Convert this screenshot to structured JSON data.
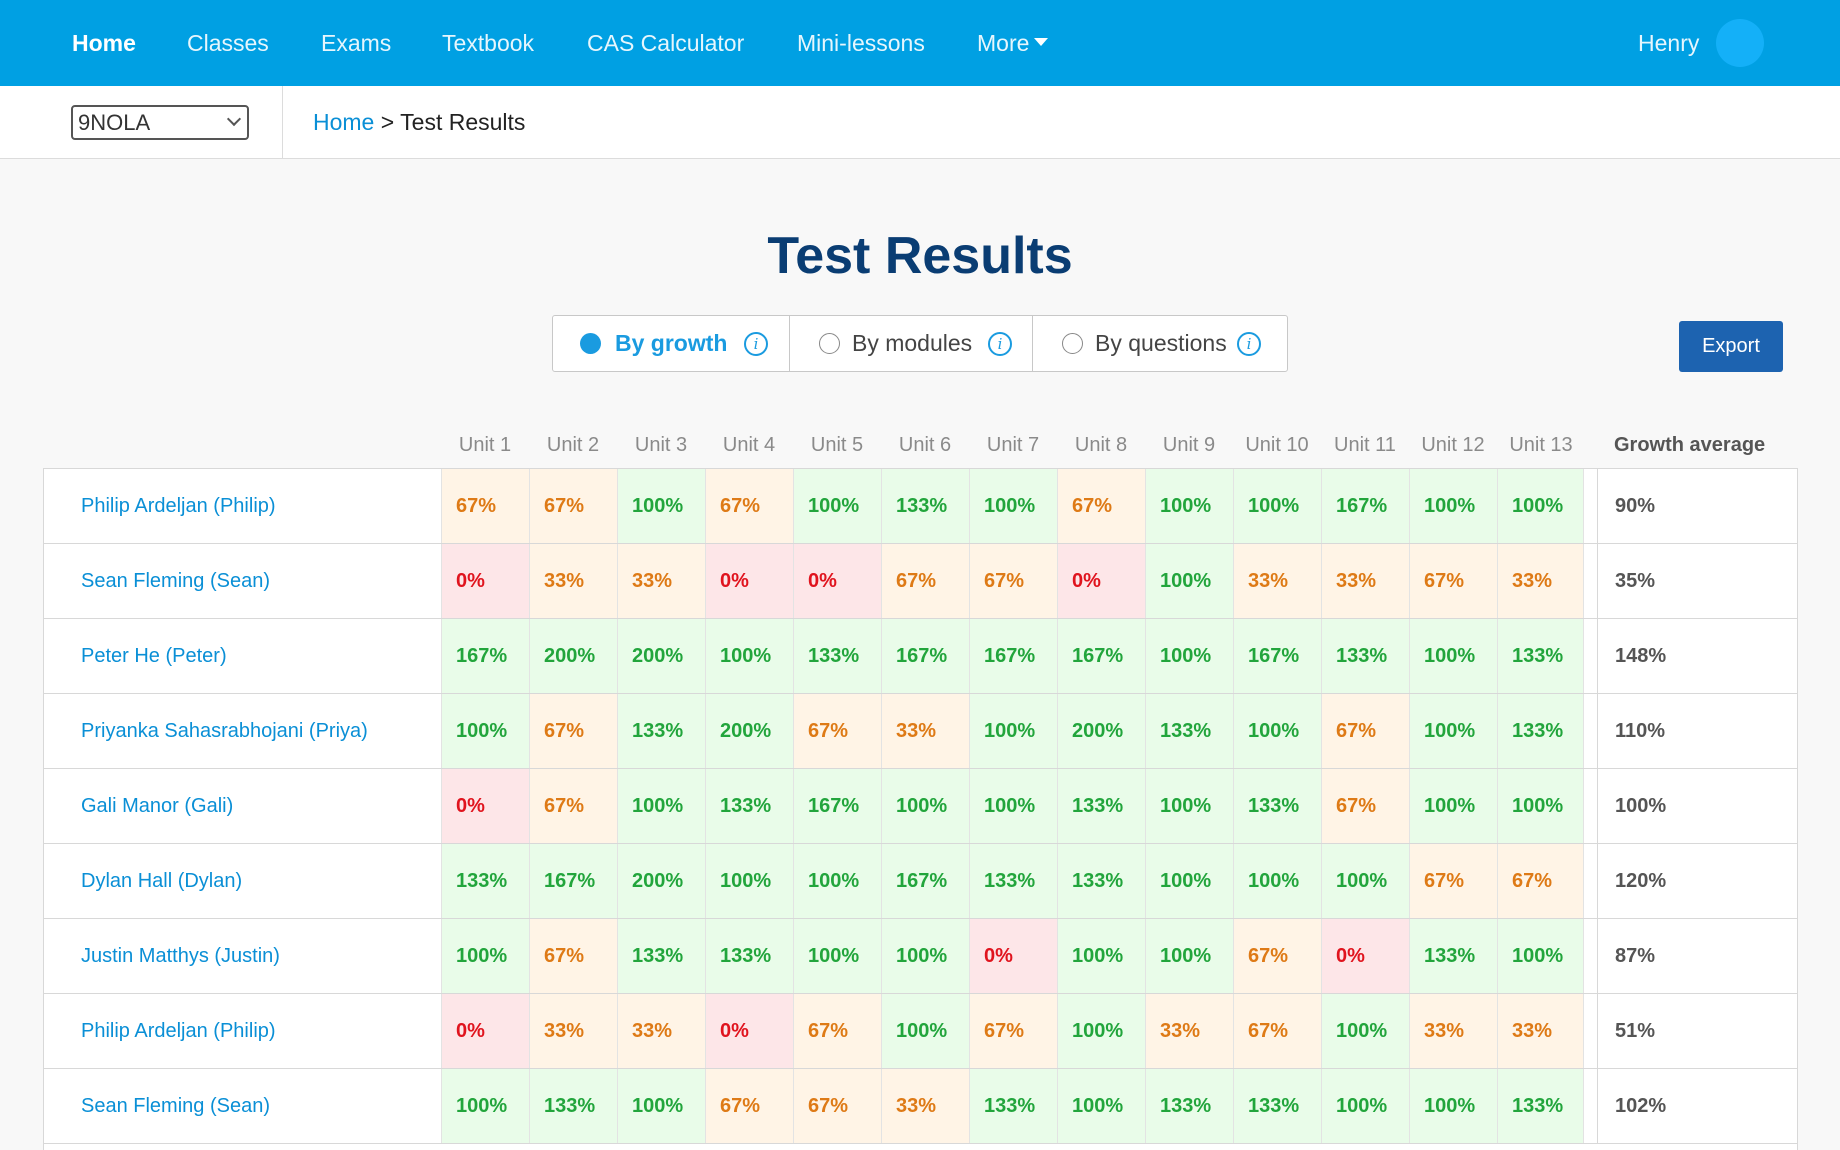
{
  "nav": {
    "items": [
      {
        "label": "Home",
        "active": true
      },
      {
        "label": "Classes"
      },
      {
        "label": "Exams"
      },
      {
        "label": "Textbook"
      },
      {
        "label": "CAS Calculator"
      },
      {
        "label": "Mini-lessons"
      },
      {
        "label": "More"
      }
    ],
    "user_name": "Henry",
    "colors": {
      "bar": "#00a0e3"
    }
  },
  "class_select": {
    "value": "9NOLA"
  },
  "breadcrumb": {
    "home": "Home",
    "separator": ">",
    "current": "Test Results"
  },
  "page_title": "Test Results",
  "view_options": [
    {
      "label": "By growth",
      "selected": true
    },
    {
      "label": "By modules",
      "selected": false
    },
    {
      "label": "By questions",
      "selected": false
    }
  ],
  "export_label": "Export",
  "table": {
    "columns": [
      "Unit 1",
      "Unit 2",
      "Unit 3",
      "Unit 4",
      "Unit 5",
      "Unit 6",
      "Unit 7",
      "Unit 8",
      "Unit 9",
      "Unit 10",
      "Unit 11",
      "Unit 12",
      "Unit 13"
    ],
    "average_header": "Growth average",
    "status_colors": {
      "high": "#22a53c",
      "mid": "#de7a16",
      "low": "#e0141e"
    },
    "rows": [
      {
        "name": "Philip Ardeljan (Philip)",
        "cells": [
          "67%",
          "67%",
          "100%",
          "67%",
          "100%",
          "133%",
          "100%",
          "67%",
          "100%",
          "100%",
          "167%",
          "100%",
          "100%"
        ],
        "average": "90%"
      },
      {
        "name": "Sean Fleming (Sean)",
        "cells": [
          "0%",
          "33%",
          "33%",
          "0%",
          "0%",
          "67%",
          "67%",
          "0%",
          "100%",
          "33%",
          "33%",
          "67%",
          "33%"
        ],
        "average": "35%"
      },
      {
        "name": "Peter He (Peter)",
        "cells": [
          "167%",
          "200%",
          "200%",
          "100%",
          "133%",
          "167%",
          "167%",
          "167%",
          "100%",
          "167%",
          "133%",
          "100%",
          "133%"
        ],
        "average": "148%"
      },
      {
        "name": "Priyanka Sahasrabhojani (Priya)",
        "cells": [
          "100%",
          "67%",
          "133%",
          "200%",
          "67%",
          "33%",
          "100%",
          "200%",
          "133%",
          "100%",
          "67%",
          "100%",
          "133%"
        ],
        "average": "110%"
      },
      {
        "name": "Gali Manor (Gali)",
        "cells": [
          "0%",
          "67%",
          "100%",
          "133%",
          "167%",
          "100%",
          "100%",
          "133%",
          "100%",
          "133%",
          "67%",
          "100%",
          "100%"
        ],
        "average": "100%"
      },
      {
        "name": "Dylan Hall (Dylan)",
        "cells": [
          "133%",
          "167%",
          "200%",
          "100%",
          "100%",
          "167%",
          "133%",
          "133%",
          "100%",
          "100%",
          "100%",
          "67%",
          "67%"
        ],
        "average": "120%"
      },
      {
        "name": "Justin Matthys (Justin)",
        "cells": [
          "100%",
          "67%",
          "133%",
          "133%",
          "100%",
          "100%",
          "0%",
          "100%",
          "100%",
          "67%",
          "0%",
          "133%",
          "100%"
        ],
        "average": "87%"
      },
      {
        "name": "Philip Ardeljan (Philip)",
        "cells": [
          "0%",
          "33%",
          "33%",
          "0%",
          "67%",
          "100%",
          "67%",
          "100%",
          "33%",
          "67%",
          "100%",
          "33%",
          "33%"
        ],
        "average": "51%"
      },
      {
        "name": "Sean Fleming (Sean)",
        "cells": [
          "100%",
          "133%",
          "100%",
          "67%",
          "67%",
          "33%",
          "133%",
          "100%",
          "133%",
          "133%",
          "100%",
          "100%",
          "133%"
        ],
        "average": "102%"
      }
    ]
  }
}
